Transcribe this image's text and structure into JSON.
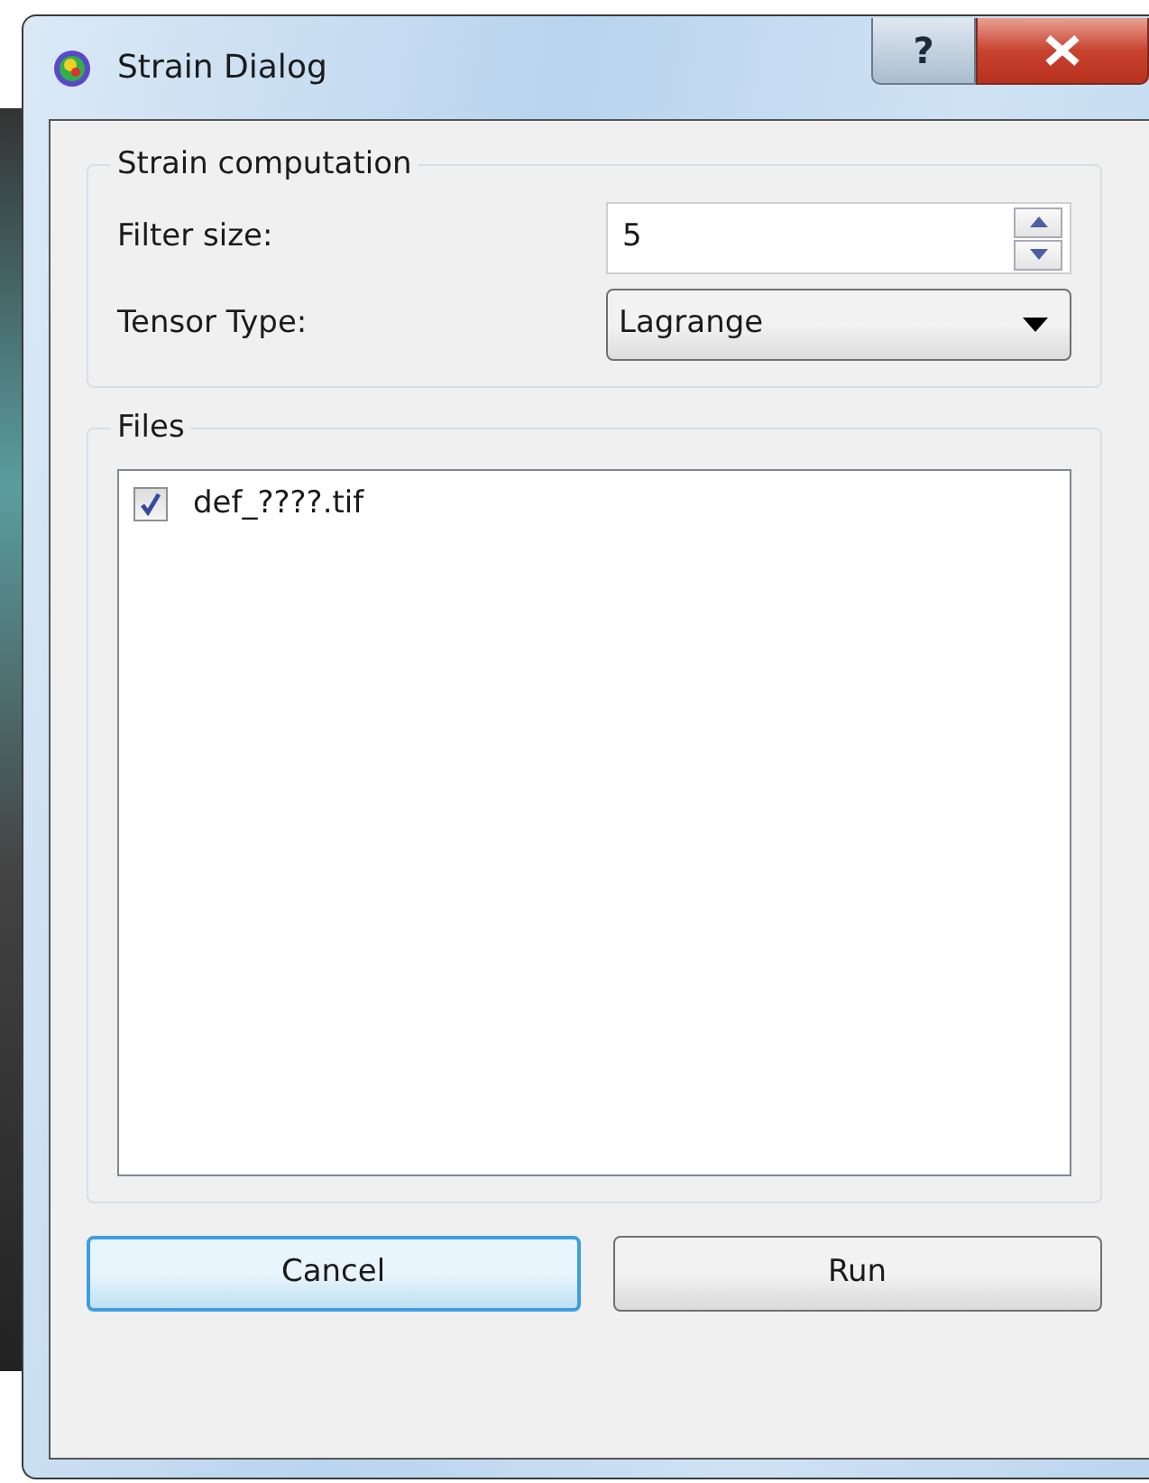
{
  "window": {
    "title": "Strain Dialog",
    "help_label": "?"
  },
  "strain_group": {
    "title": "Strain computation",
    "filter_label": "Filter size:",
    "filter_value": "5",
    "tensor_label": "Tensor Type:",
    "tensor_value": "Lagrange"
  },
  "files_group": {
    "title": "Files",
    "items": [
      {
        "label": "def_????.tif",
        "checked": true
      }
    ]
  },
  "buttons": [
    {
      "label": "Cancel",
      "focused": true
    },
    {
      "label": "Run",
      "focused": false
    }
  ]
}
